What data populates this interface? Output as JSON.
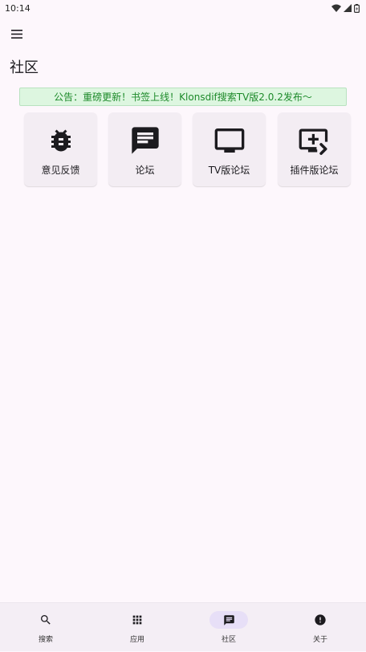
{
  "status_bar": {
    "time": "10:14"
  },
  "page_title": "社区",
  "notice": "公告：重磅更新！书签上线！Klonsdif搜索TV版2.0.2发布〜",
  "cards": [
    {
      "label": "意见反馈",
      "icon": "bug-icon"
    },
    {
      "label": "论坛",
      "icon": "forum-message-icon"
    },
    {
      "label": "TV版论坛",
      "icon": "tv-icon"
    },
    {
      "label": "插件版论坛",
      "icon": "add-to-queue-icon"
    }
  ],
  "bottom_nav": {
    "items": [
      {
        "label": "搜索",
        "icon": "search-icon"
      },
      {
        "label": "应用",
        "icon": "apps-grid-icon"
      },
      {
        "label": "社区",
        "icon": "forum-message-icon",
        "active": true
      },
      {
        "label": "关于",
        "icon": "info-icon"
      }
    ]
  }
}
